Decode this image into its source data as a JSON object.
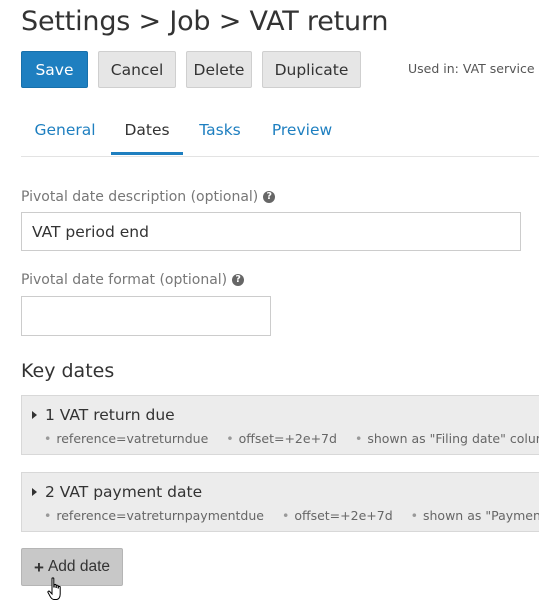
{
  "header": {
    "title": "Settings > Job > VAT return"
  },
  "toolbar": {
    "save_label": "Save",
    "cancel_label": "Cancel",
    "delete_label": "Delete",
    "duplicate_label": "Duplicate",
    "used_in": "Used in: VAT service"
  },
  "tabs": [
    {
      "label": "General",
      "active": false
    },
    {
      "label": "Dates",
      "active": true
    },
    {
      "label": "Tasks",
      "active": false
    },
    {
      "label": "Preview",
      "active": false
    }
  ],
  "form": {
    "pivotal_description": {
      "label": "Pivotal date description (optional)",
      "value": "VAT period end"
    },
    "pivotal_format": {
      "label": "Pivotal date format (optional)",
      "value": ""
    }
  },
  "key_dates": {
    "heading": "Key dates",
    "items": [
      {
        "title": "1 VAT return due",
        "reference": "reference=vatreturndue",
        "offset": "offset=+2e+7d",
        "shown_as": "shown as \"Filing date\" column"
      },
      {
        "title": "2 VAT payment date",
        "reference": "reference=vatreturnpaymentdue",
        "offset": "offset=+2e+7d",
        "shown_as": "shown as \"Payment date\" column"
      }
    ],
    "add_label": "Add date"
  },
  "colors": {
    "primary": "#1e7fc0",
    "tab_link": "#1e7fc0"
  }
}
